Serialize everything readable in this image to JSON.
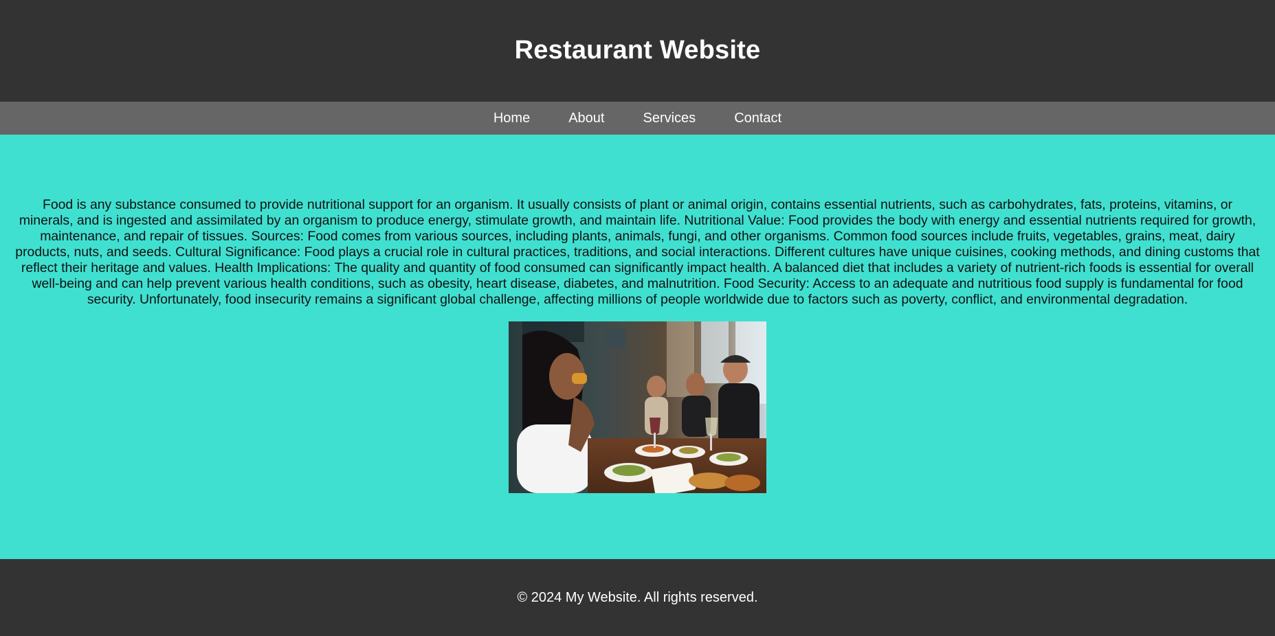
{
  "header": {
    "title": "Restaurant Website"
  },
  "nav": {
    "items": [
      {
        "label": "Home"
      },
      {
        "label": "About"
      },
      {
        "label": "Services"
      },
      {
        "label": "Contact"
      }
    ]
  },
  "main": {
    "paragraph": "Food is any substance consumed to provide nutritional support for an organism. It usually consists of plant or animal origin, contains essential nutrients, such as carbohydrates, fats, proteins, vitamins, or minerals, and is ingested and assimilated by an organism to produce energy, stimulate growth, and maintain life. Nutritional Value: Food provides the body with energy and essential nutrients required for growth, maintenance, and repair of tissues. Sources: Food comes from various sources, including plants, animals, fungi, and other organisms. Common food sources include fruits, vegetables, grains, meat, dairy products, nuts, and seeds. Cultural Significance: Food plays a crucial role in cultural practices, traditions, and social interactions. Different cultures have unique cuisines, cooking methods, and dining customs that reflect their heritage and values. Health Implications: The quality and quantity of food consumed can significantly impact health. A balanced diet that includes a variety of nutrient-rich foods is essential for overall well-being and can help prevent various health conditions, such as obesity, heart disease, diabetes, and malnutrition. Food Security: Access to an adequate and nutritious food supply is fundamental for food security. Unfortunately, food insecurity remains a significant global challenge, affecting millions of people worldwide due to factors such as poverty, conflict, and environmental degradation."
  },
  "footer": {
    "copyright": "© 2024 My Website. All rights reserved."
  },
  "colors": {
    "header_bg": "#333333",
    "nav_bg": "#666666",
    "main_bg": "#40e0d0",
    "footer_bg": "#333333",
    "text_light": "#ffffff",
    "text_dark": "#111111"
  }
}
